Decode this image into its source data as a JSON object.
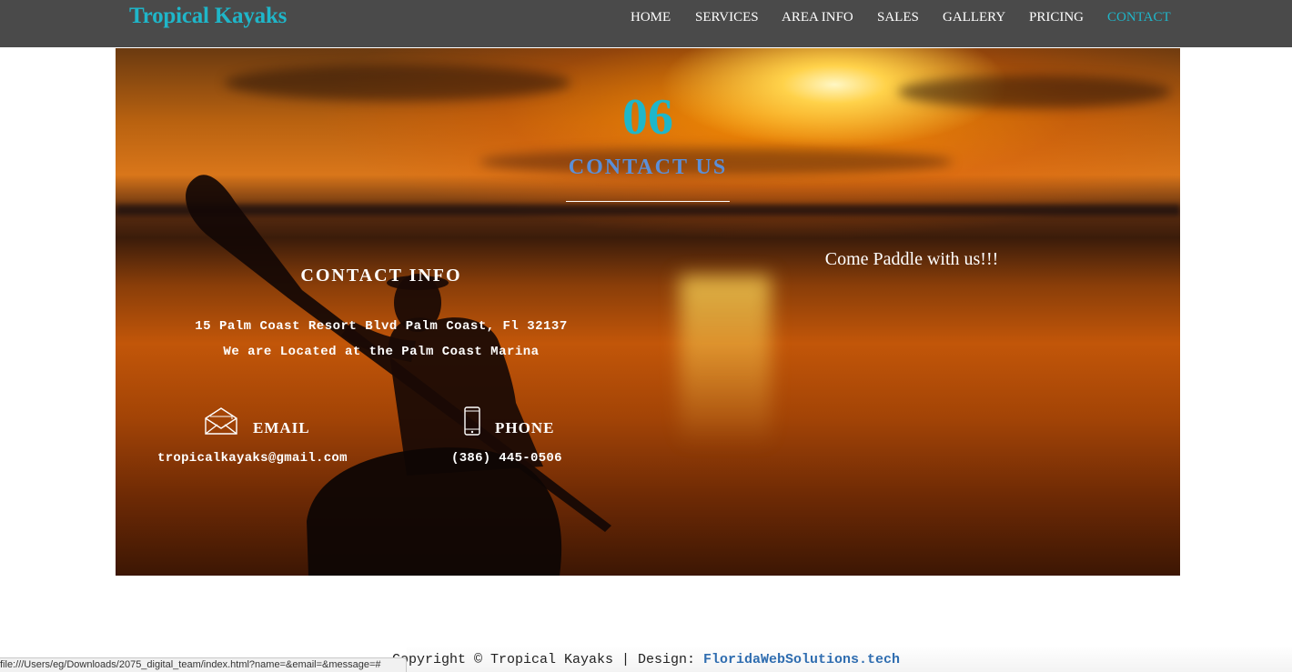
{
  "header": {
    "brand": "Tropical Kayaks",
    "nav": [
      {
        "label": "HOME",
        "active": false
      },
      {
        "label": "SERVICES",
        "active": false
      },
      {
        "label": "AREA INFO",
        "active": false
      },
      {
        "label": "SALES",
        "active": false
      },
      {
        "label": "GALLERY",
        "active": false
      },
      {
        "label": "PRICING",
        "active": false
      },
      {
        "label": "CONTACT",
        "active": true
      }
    ]
  },
  "contact_section": {
    "number": "06",
    "title": "CONTACT US",
    "info_heading": "CONTACT INFO",
    "address_line1": "15 Palm Coast Resort Blvd Palm Coast, Fl 32137",
    "address_line2": "We are Located at the Palm Coast Marina",
    "email": {
      "label": "EMAIL",
      "value": "tropicalkayaks@gmail.com",
      "icon": "envelope-icon"
    },
    "phone": {
      "label": "PHONE",
      "value": "(386) 445-0506",
      "icon": "mobile-phone-icon"
    },
    "tagline": "Come Paddle with us!!!"
  },
  "footer": {
    "text": "Copyright © Tropical Kayaks | Design: ",
    "link_text": "FloridaWebSolutions.tech"
  },
  "browser_status": {
    "url": "file:///Users/eg/Downloads/2075_digital_team/index.html?name=&email=&message=#"
  },
  "colors": {
    "accent": "#1fb6c9",
    "nav_bg": "#4a4a4a",
    "section_title": "#5b8fd8",
    "footer_link": "#2f6db0"
  }
}
